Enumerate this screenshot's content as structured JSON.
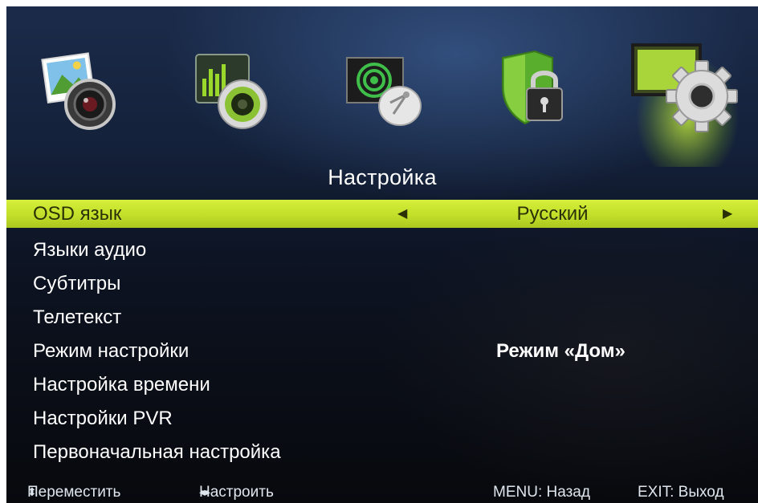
{
  "menu": {
    "title": "Настройка",
    "items": [
      {
        "label": "OSD язык",
        "value": "Русский",
        "selected": true
      },
      {
        "label": "Языки аудио",
        "value": ""
      },
      {
        "label": "Субтитры",
        "value": ""
      },
      {
        "label": "Телетекст",
        "value": ""
      },
      {
        "label": "Режим настройки",
        "value": "Режим «Дом»"
      },
      {
        "label": "Настройка времени",
        "value": ""
      },
      {
        "label": "Настройки PVR",
        "value": ""
      },
      {
        "label": "Первоначальная настройка",
        "value": ""
      }
    ]
  },
  "icons": [
    {
      "name": "picture-icon",
      "selected": false
    },
    {
      "name": "sound-icon",
      "selected": false
    },
    {
      "name": "channel-icon",
      "selected": false
    },
    {
      "name": "lock-icon",
      "selected": false
    },
    {
      "name": "settings-gear-icon",
      "selected": true
    }
  ],
  "footer": {
    "move_icon": "⬍",
    "move": "Переместить",
    "adjust_icon": "◂▸",
    "adjust": "Настроить",
    "menu": "MENU: Назад",
    "exit": "EXIT: Выход"
  },
  "colors": {
    "highlight": "#c8e22e",
    "text": "#ffffff",
    "background": "#0d1424"
  }
}
